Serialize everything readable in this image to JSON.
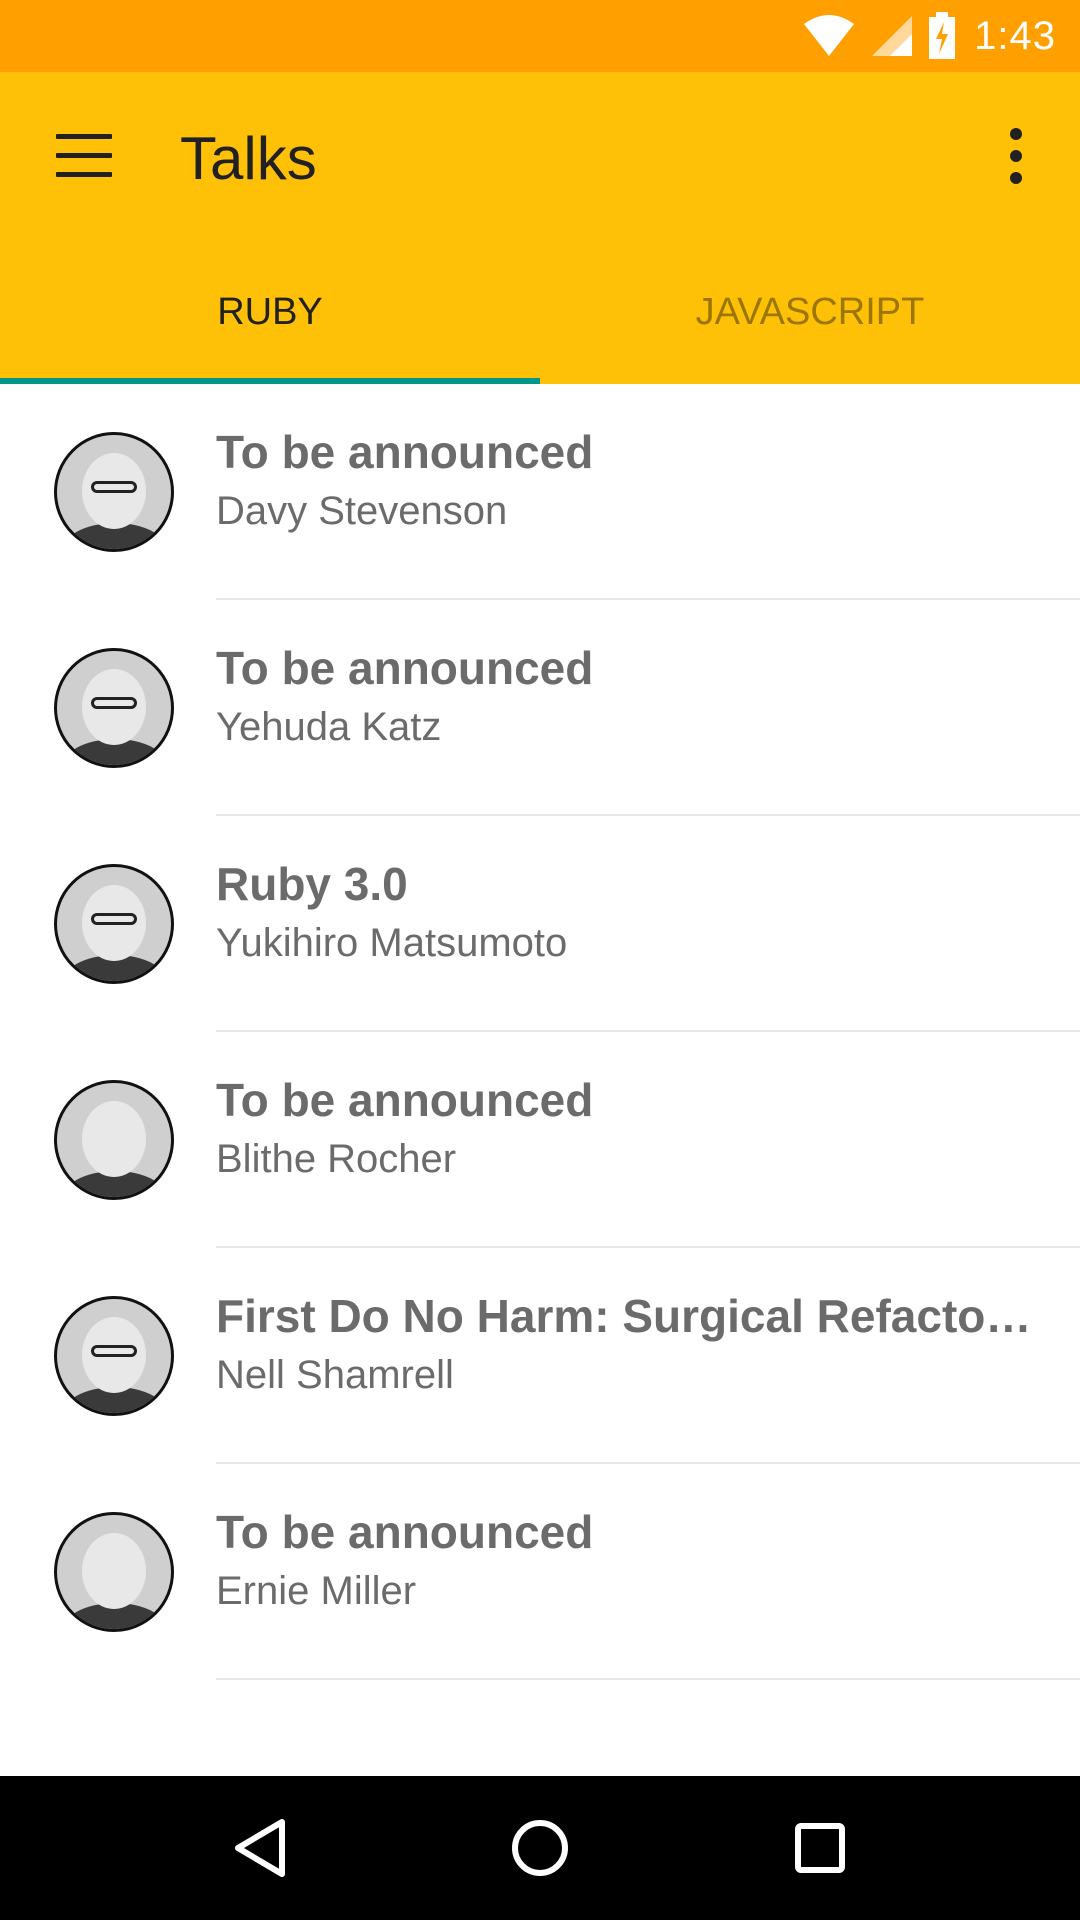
{
  "status_bar": {
    "time": "1:43",
    "icons": [
      "wifi-icon",
      "signal-icon",
      "battery-charging-icon"
    ],
    "background": "#FFA000"
  },
  "toolbar": {
    "title": "Talks",
    "menu_icon": "hamburger-menu-icon",
    "overflow_icon": "more-vert-icon",
    "background": "#FFC107"
  },
  "tabs": {
    "items": [
      {
        "label": "RUBY",
        "selected": true
      },
      {
        "label": "JAVASCRIPT",
        "selected": false
      }
    ],
    "indicator_color": "#009688"
  },
  "talks": [
    {
      "title": "To be announced",
      "speaker": "Davy Stevenson",
      "avatar": "avatar-davy-stevenson"
    },
    {
      "title": "To be announced",
      "speaker": "Yehuda Katz",
      "avatar": "avatar-yehuda-katz"
    },
    {
      "title": "Ruby 3.0",
      "speaker": "Yukihiro Matsumoto",
      "avatar": "avatar-yukihiro-matsumoto"
    },
    {
      "title": "To be announced",
      "speaker": "Blithe Rocher",
      "avatar": "avatar-blithe-rocher"
    },
    {
      "title": "First Do No Harm: Surgical Refactor…",
      "speaker": "Nell Shamrell",
      "avatar": "avatar-nell-shamrell"
    },
    {
      "title": "To be announced",
      "speaker": "Ernie Miller",
      "avatar": "avatar-ernie-miller"
    }
  ],
  "nav_bar": {
    "buttons": [
      "back-icon",
      "home-icon",
      "recents-icon"
    ]
  }
}
